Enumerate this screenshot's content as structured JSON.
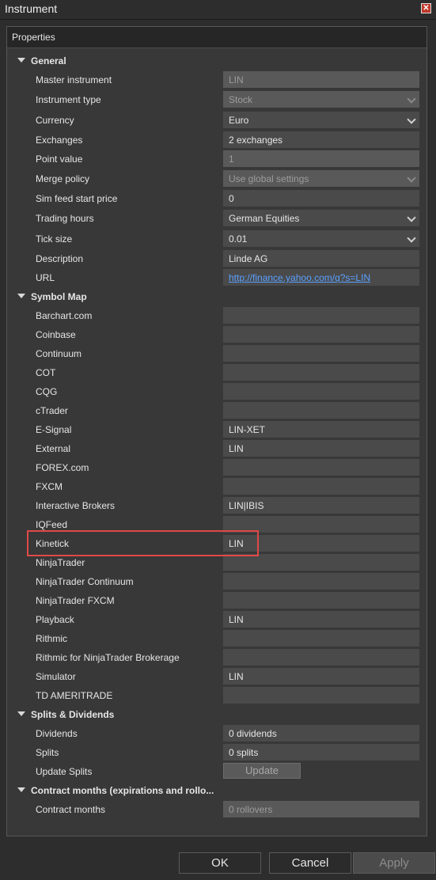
{
  "window": {
    "title": "Instrument"
  },
  "panel": {
    "header": "Properties"
  },
  "general": {
    "label": "General",
    "master_instrument": {
      "label": "Master instrument",
      "value": "LIN"
    },
    "instrument_type": {
      "label": "Instrument type",
      "value": "Stock"
    },
    "currency": {
      "label": "Currency",
      "value": "Euro"
    },
    "exchanges": {
      "label": "Exchanges",
      "value": "2 exchanges"
    },
    "point_value": {
      "label": "Point value",
      "value": "1"
    },
    "merge_policy": {
      "label": "Merge policy",
      "value": "Use global settings"
    },
    "sim_feed_start_price": {
      "label": "Sim feed start price",
      "value": "0"
    },
    "trading_hours": {
      "label": "Trading hours",
      "value": "German Equities"
    },
    "tick_size": {
      "label": "Tick size",
      "value": "0.01"
    },
    "description": {
      "label": "Description",
      "value": "Linde AG"
    },
    "url": {
      "label": "URL",
      "value": "http://finance.yahoo.com/q?s=LIN"
    }
  },
  "symbol_map": {
    "label": "Symbol Map",
    "items": [
      {
        "label": "Barchart.com",
        "value": ""
      },
      {
        "label": "Coinbase",
        "value": ""
      },
      {
        "label": "Continuum",
        "value": ""
      },
      {
        "label": "COT",
        "value": ""
      },
      {
        "label": "CQG",
        "value": ""
      },
      {
        "label": "cTrader",
        "value": ""
      },
      {
        "label": "E-Signal",
        "value": "LIN-XET"
      },
      {
        "label": "External",
        "value": "LIN"
      },
      {
        "label": "FOREX.com",
        "value": ""
      },
      {
        "label": "FXCM",
        "value": ""
      },
      {
        "label": "Interactive Brokers",
        "value": "LIN|IBIS"
      },
      {
        "label": "IQFeed",
        "value": ""
      },
      {
        "label": "Kinetick",
        "value": "LIN"
      },
      {
        "label": "NinjaTrader",
        "value": ""
      },
      {
        "label": "NinjaTrader Continuum",
        "value": ""
      },
      {
        "label": "NinjaTrader FXCM",
        "value": ""
      },
      {
        "label": "Playback",
        "value": "LIN"
      },
      {
        "label": "Rithmic",
        "value": ""
      },
      {
        "label": "Rithmic for NinjaTrader Brokerage",
        "value": ""
      },
      {
        "label": "Simulator",
        "value": "LIN"
      },
      {
        "label": "TD AMERITRADE",
        "value": ""
      }
    ]
  },
  "splits_dividends": {
    "label": "Splits & Dividends",
    "dividends": {
      "label": "Dividends",
      "value": "0 dividends"
    },
    "splits": {
      "label": "Splits",
      "value": "0 splits"
    },
    "update_splits": {
      "label": "Update Splits",
      "button": "Update"
    }
  },
  "contract_months": {
    "label": "Contract months (expirations and rollo...",
    "contract_months": {
      "label": "Contract months",
      "value": "0 rollovers"
    }
  },
  "footer": {
    "ok": "OK",
    "cancel": "Cancel",
    "apply": "Apply"
  },
  "colors": {
    "highlight": "#e04848",
    "link": "#5aa0ff",
    "background": "#2d2d2d"
  }
}
